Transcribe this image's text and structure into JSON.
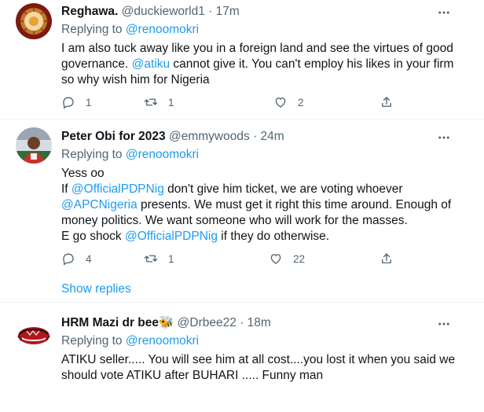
{
  "tweets": [
    {
      "name": "Reghawa.",
      "handle": "@duckieworld1",
      "sep": "·",
      "time": "17m",
      "replying_prefix": "Replying to",
      "replying_to": "@renoomokri",
      "text_parts": [
        "I am also tuck away like you in a foreign land and see the virtues of good governance. ",
        "@atiku",
        " cannot give it. You can't employ his likes in your firm so why wish him for Nigeria"
      ],
      "stats": {
        "replies": "1",
        "retweets": "1",
        "likes": "2"
      }
    },
    {
      "name": "Peter Obi for 2023",
      "handle": "@emmywoods",
      "sep": "·",
      "time": "24m",
      "replying_prefix": "Replying to",
      "replying_to": "@renoomokri",
      "line1": "Yess oo",
      "line2_parts": [
        "If ",
        "@OfficialPDPNig",
        " don't give him ticket, we are voting whoever"
      ],
      "line3_parts": [
        "@APCNigeria",
        " presents. We must get it right this time around. Enough of money politics. We want someone who will work for the masses."
      ],
      "line4_parts": [
        "E go shock ",
        "@OfficialPDPNig",
        " if they do otherwise."
      ],
      "stats": {
        "replies": "4",
        "retweets": "1",
        "likes": "22"
      },
      "show_replies": "Show replies"
    },
    {
      "name": "HRM Mazi dr bee",
      "emoji": "🐝",
      "handle": "@Drbee22",
      "sep": "·",
      "time": "18m",
      "replying_prefix": "Replying to",
      "replying_to": "@renoomokri",
      "text": "ATIKU seller..... You will see him at all cost....you lost it when you said we should vote ATIKU after BUHARI ..... Funny man"
    }
  ],
  "colors": {
    "link": "#1d9bf0",
    "secondary": "#536471",
    "divider": "#eff3f4"
  }
}
